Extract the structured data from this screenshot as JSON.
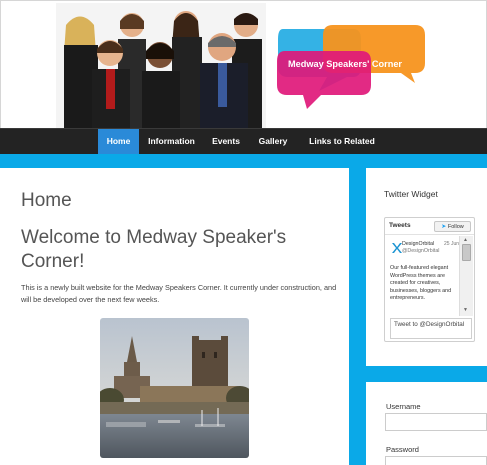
{
  "header": {
    "logo_line": "Medway Speakers' Corner"
  },
  "nav": {
    "items": [
      {
        "label": "Home",
        "active": true
      },
      {
        "label": "Information",
        "active": false
      },
      {
        "label": "Events",
        "active": false
      },
      {
        "label": "Gallery",
        "active": false
      },
      {
        "label": "Links to Related Sites",
        "active": false
      }
    ]
  },
  "main": {
    "page_title": "Home",
    "heading": "Welcome to Medway Speaker's Corner!",
    "intro": "This is a newly built website for the Medway Speakers Corner. It currently under construction, and will be developed over the next few weeks."
  },
  "sidebar": {
    "widget_title": "Twitter Widget",
    "twitter": {
      "header_label": "Tweets",
      "follow_label": "Follow",
      "tweet": {
        "name": "DesignOrbital",
        "date": "25 Jun",
        "handle": "@DesignOrbital",
        "body": "Our full-featured elegant WordPress themes are created for creatives, businesses, bloggers and entrepreneurs."
      },
      "compose_text": "Tweet to @DesignOrbital"
    },
    "login": {
      "username_label": "Username",
      "password_label": "Password"
    }
  },
  "colors": {
    "accent": "#0aa9e8",
    "nav_bg": "#232323",
    "nav_active": "#2a8ad8"
  }
}
